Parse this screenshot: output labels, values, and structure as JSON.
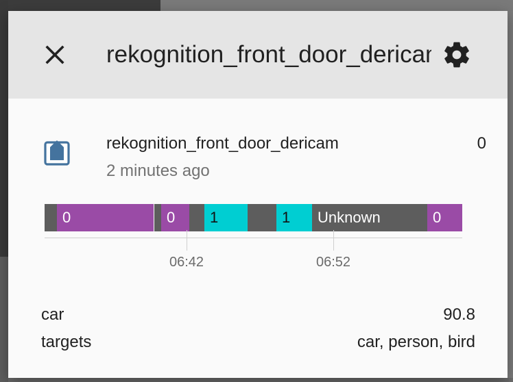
{
  "dialog": {
    "title": "rekognition_front_door_dericam",
    "close_icon": "close-icon",
    "settings_icon": "gear-icon"
  },
  "entity": {
    "icon": "camera-frame-icon",
    "name": "rekognition_front_door_dericam",
    "last_changed": "2 minutes ago",
    "state": "0"
  },
  "timeline": {
    "colors": {
      "gray": "#5d5d5d",
      "purple": "#9a4ba6",
      "cyan": "#00ced2"
    },
    "segments": [
      {
        "label": "",
        "color": "gray",
        "start": 0.0,
        "end": 0.03
      },
      {
        "label": "0",
        "color": "purple",
        "start": 0.03,
        "end": 0.262
      },
      {
        "label": "",
        "color": "gray",
        "start": 0.262,
        "end": 0.279
      },
      {
        "label": "0",
        "color": "purple",
        "start": 0.279,
        "end": 0.346
      },
      {
        "label": "",
        "color": "gray",
        "start": 0.346,
        "end": 0.383
      },
      {
        "label": "1",
        "color": "cyan",
        "start": 0.383,
        "end": 0.486
      },
      {
        "label": "",
        "color": "gray",
        "start": 0.486,
        "end": 0.555
      },
      {
        "label": "1",
        "color": "cyan",
        "start": 0.555,
        "end": 0.64
      },
      {
        "label": "Unknown",
        "color": "gray",
        "start": 0.64,
        "end": 0.917
      },
      {
        "label": "0",
        "color": "purple",
        "start": 0.917,
        "end": 1.0
      }
    ],
    "ticks": [
      {
        "label": "06:42",
        "at": 0.34
      },
      {
        "label": "06:52",
        "at": 0.692
      }
    ]
  },
  "attributes": [
    {
      "name": "car",
      "value": "90.8"
    },
    {
      "name": "targets",
      "value": "car, person, bird"
    }
  ]
}
